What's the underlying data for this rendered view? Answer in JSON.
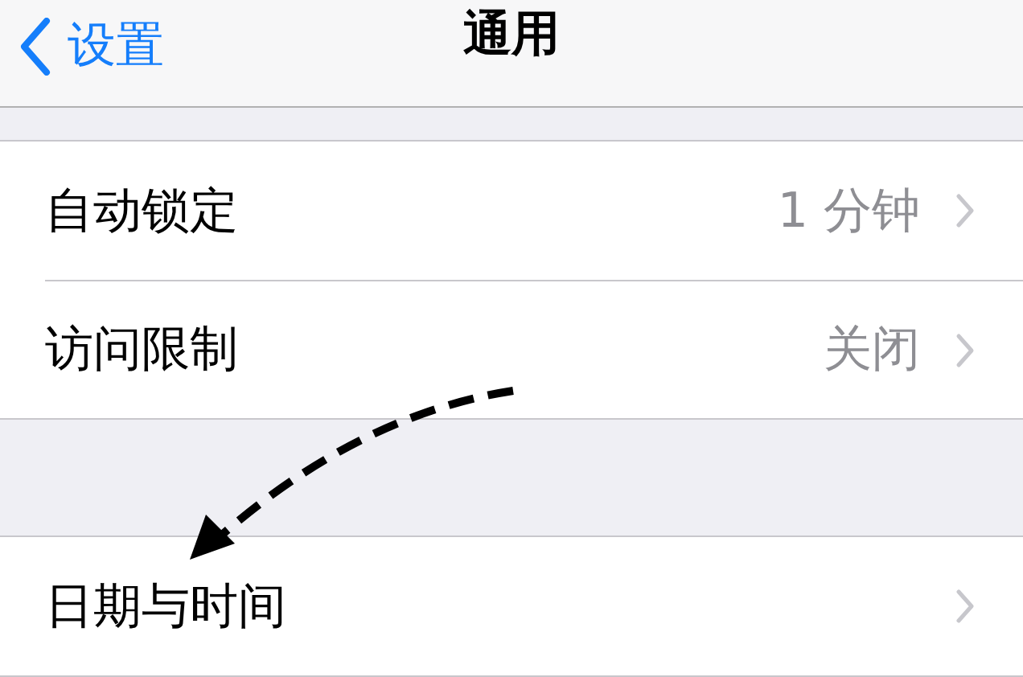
{
  "nav": {
    "back_label": "设置",
    "title": "通用"
  },
  "groups": [
    {
      "rows": [
        {
          "label": "自动锁定",
          "value": "1 分钟"
        },
        {
          "label": "访问限制",
          "value": "关闭"
        }
      ]
    },
    {
      "rows": [
        {
          "label": "日期与时间"
        }
      ]
    }
  ]
}
